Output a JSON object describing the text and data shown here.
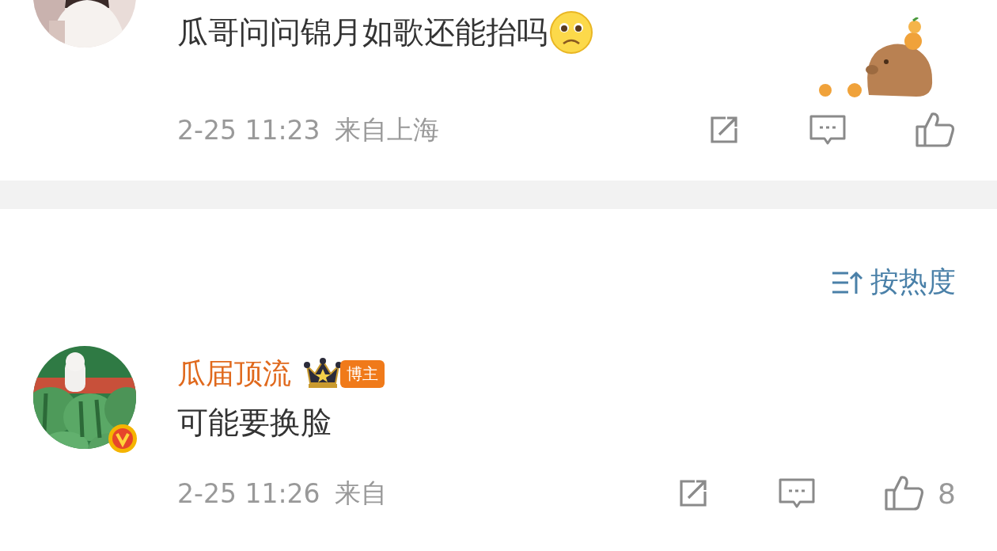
{
  "comments": [
    {
      "text": "瓜哥问问锦月如歌还能抬吗",
      "emoji": true,
      "sticker": true,
      "time": "2-25 11:23",
      "location": "来自上海"
    },
    {
      "author": "瓜届顶流",
      "badge": "博主",
      "verified": true,
      "text": "可能要换脸",
      "time": "2-25 11:26",
      "location": "来自",
      "like_count": "8"
    }
  ],
  "sort": {
    "label": "按热度"
  }
}
